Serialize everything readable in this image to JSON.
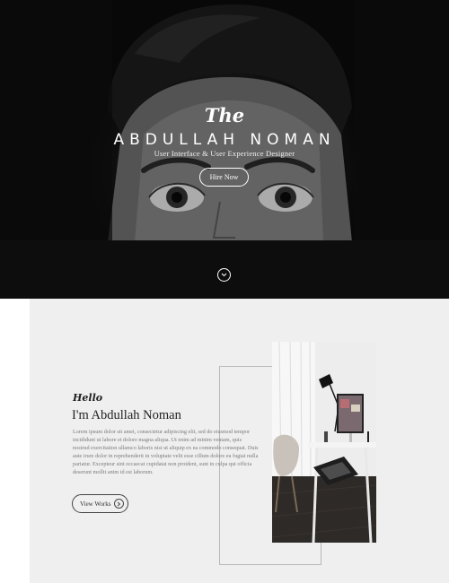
{
  "hero": {
    "script_title": "The",
    "name": "ABDULLAH NOMAN",
    "subtitle": "User Interface & User Experience Designer",
    "hire_button": "Hire Now",
    "scroll_icon": "chevron-down-circle-icon"
  },
  "about": {
    "hello": "Hello",
    "heading": "I'm Abdullah Noman",
    "body": "Lorem ipsum dolor sit amet, consectetur adipiscing elit, sed do eiusmod tempor incididunt ut labore et dolore magna aliqua. Ut enim ad minim veniam, quis nostrud exercitation ullamco laboris nisi ut aliquip ex ea commodo consequat. Duis aute irure dolor in reprehenderit in voluptate velit esse cillum dolore eu fugiat nulla pariatur. Excepteur sint occaecat cupidatat non proident, sunt in culpa qui officia deserunt mollit anim id est laborum.",
    "view_button": "View Works",
    "view_icon": "chevron-right-circle-icon"
  },
  "colors": {
    "hero_bg": "#111111",
    "about_bg": "#efefef",
    "text_dark": "#222222",
    "text_muted": "#7a7a7a"
  }
}
